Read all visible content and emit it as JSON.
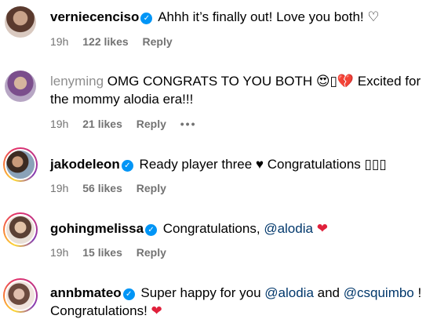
{
  "comments": [
    {
      "username": "verniecenciso",
      "verified": true,
      "text": "Ahhh it’s finally out! Love you both! ♡",
      "time": "19h",
      "likes": "122 likes",
      "reply": "Reply"
    },
    {
      "username": "lenyming",
      "verified": false,
      "text": "OMG CONGRATS TO YOU BOTH 😍▯💔 Excited for the mommy alodia era!!!",
      "time": "19h",
      "likes": "21 likes",
      "reply": "Reply",
      "more": "•••"
    },
    {
      "username": "jakodeleon",
      "verified": true,
      "text": "Ready player three ♥ Congratulations ▯▯▯",
      "time": "19h",
      "likes": "56 likes",
      "reply": "Reply"
    },
    {
      "username": "gohingmelissa",
      "verified": true,
      "text_before": "Congratulations,",
      "mention": "@alodia",
      "heart": "❤",
      "time": "19h",
      "likes": "15 likes",
      "reply": "Reply"
    },
    {
      "username": "annbmateo",
      "verified": true,
      "text_part1": "Super happy for you",
      "mention1": "@alodia",
      "text_part2": "and",
      "mention2": "@csquimbo",
      "text_part3": "! Congratulations!",
      "heart": "❤"
    }
  ],
  "colors": {
    "verified": "#0095f6",
    "mention": "#00376b",
    "meta": "#737373",
    "heart": "#e0203b"
  }
}
